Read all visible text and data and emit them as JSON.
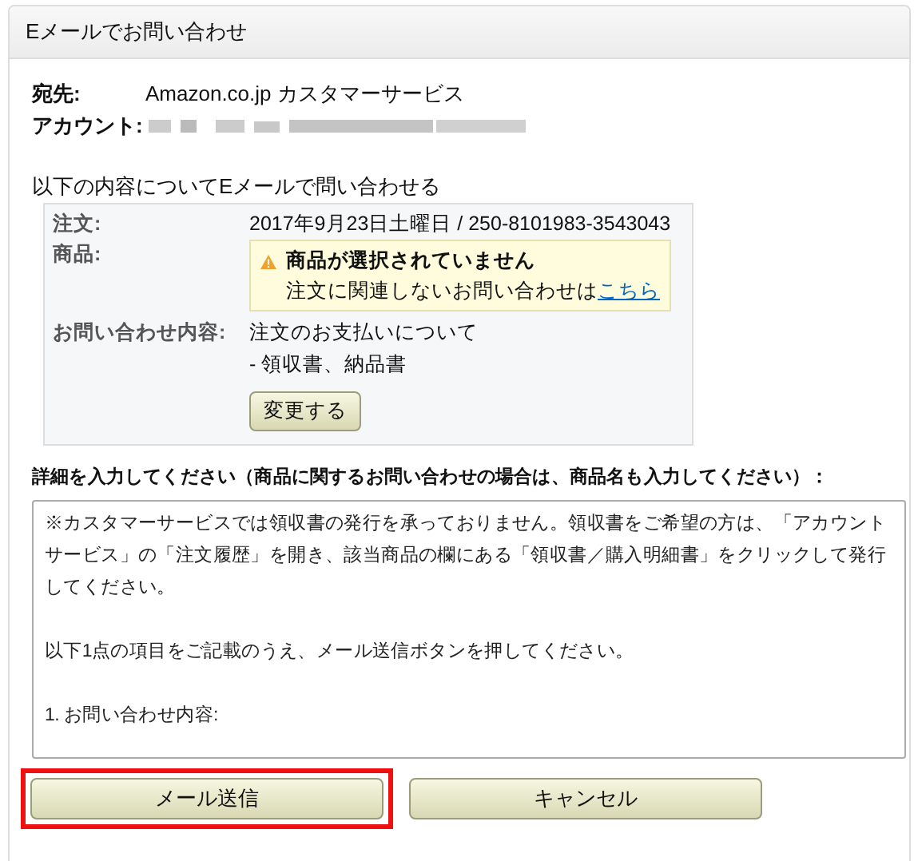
{
  "panel": {
    "title": "Eメールでお問い合わせ"
  },
  "recipient": {
    "label": "宛先:",
    "value": "Amazon.co.jp カスタマーサービス"
  },
  "account": {
    "label": "アカウント:",
    "redacted": true
  },
  "intro": "以下の内容についてEメールで問い合わせる",
  "order_box": {
    "order_label": "注文:",
    "order_value": "2017年9月23日土曜日 / 250-8101983-3543043",
    "product_label": "商品:",
    "warning_title": "商品が選択されていません",
    "warning_text": "注文に関連しないお問い合わせは",
    "warning_link": "こちら",
    "topic_label": "お問い合わせ内容:",
    "topic_lines": [
      "注文のお支払いについて",
      "- 領収書、納品書"
    ],
    "change_button": "変更する"
  },
  "details": {
    "label": "詳細を入力してください（商品に関するお問い合わせの場合は、商品名も入力してください）：",
    "paragraphs": [
      "※カスタマーサービスでは領収書の発行を承っておりません。領収書をご希望の方は、「アカウントサービス」の「注文履歴」を開き、該当商品の欄にある「領収書／購入明細書」をクリックして発行してください。",
      "以下1点の項目をご記載のうえ、メール送信ボタンを押してください。",
      "1. お問い合わせ内容:"
    ]
  },
  "buttons": [
    {
      "label": "メール送信",
      "highlighted": true
    },
    {
      "label": "キャンセル",
      "highlighted": false
    }
  ]
}
